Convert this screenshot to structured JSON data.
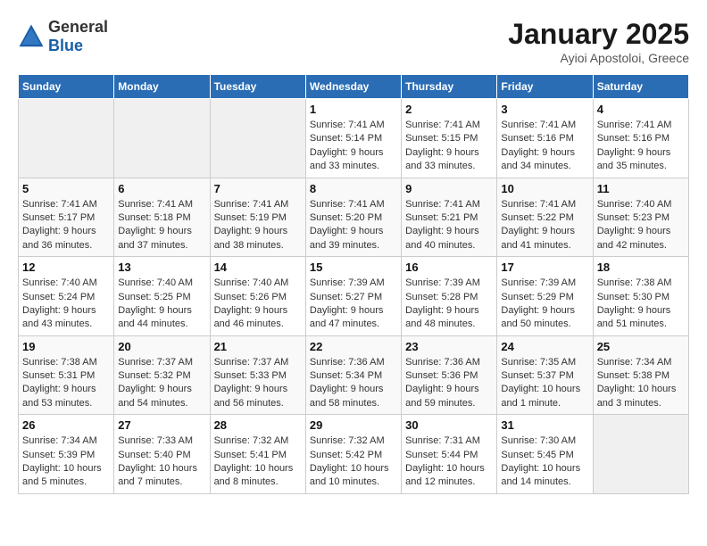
{
  "header": {
    "logo_general": "General",
    "logo_blue": "Blue",
    "month": "January 2025",
    "location": "Ayioi Apostoloi, Greece"
  },
  "weekdays": [
    "Sunday",
    "Monday",
    "Tuesday",
    "Wednesday",
    "Thursday",
    "Friday",
    "Saturday"
  ],
  "weeks": [
    [
      {
        "day": "",
        "info": ""
      },
      {
        "day": "",
        "info": ""
      },
      {
        "day": "",
        "info": ""
      },
      {
        "day": "1",
        "info": "Sunrise: 7:41 AM\nSunset: 5:14 PM\nDaylight: 9 hours and 33 minutes."
      },
      {
        "day": "2",
        "info": "Sunrise: 7:41 AM\nSunset: 5:15 PM\nDaylight: 9 hours and 33 minutes."
      },
      {
        "day": "3",
        "info": "Sunrise: 7:41 AM\nSunset: 5:16 PM\nDaylight: 9 hours and 34 minutes."
      },
      {
        "day": "4",
        "info": "Sunrise: 7:41 AM\nSunset: 5:16 PM\nDaylight: 9 hours and 35 minutes."
      }
    ],
    [
      {
        "day": "5",
        "info": "Sunrise: 7:41 AM\nSunset: 5:17 PM\nDaylight: 9 hours and 36 minutes."
      },
      {
        "day": "6",
        "info": "Sunrise: 7:41 AM\nSunset: 5:18 PM\nDaylight: 9 hours and 37 minutes."
      },
      {
        "day": "7",
        "info": "Sunrise: 7:41 AM\nSunset: 5:19 PM\nDaylight: 9 hours and 38 minutes."
      },
      {
        "day": "8",
        "info": "Sunrise: 7:41 AM\nSunset: 5:20 PM\nDaylight: 9 hours and 39 minutes."
      },
      {
        "day": "9",
        "info": "Sunrise: 7:41 AM\nSunset: 5:21 PM\nDaylight: 9 hours and 40 minutes."
      },
      {
        "day": "10",
        "info": "Sunrise: 7:41 AM\nSunset: 5:22 PM\nDaylight: 9 hours and 41 minutes."
      },
      {
        "day": "11",
        "info": "Sunrise: 7:40 AM\nSunset: 5:23 PM\nDaylight: 9 hours and 42 minutes."
      }
    ],
    [
      {
        "day": "12",
        "info": "Sunrise: 7:40 AM\nSunset: 5:24 PM\nDaylight: 9 hours and 43 minutes."
      },
      {
        "day": "13",
        "info": "Sunrise: 7:40 AM\nSunset: 5:25 PM\nDaylight: 9 hours and 44 minutes."
      },
      {
        "day": "14",
        "info": "Sunrise: 7:40 AM\nSunset: 5:26 PM\nDaylight: 9 hours and 46 minutes."
      },
      {
        "day": "15",
        "info": "Sunrise: 7:39 AM\nSunset: 5:27 PM\nDaylight: 9 hours and 47 minutes."
      },
      {
        "day": "16",
        "info": "Sunrise: 7:39 AM\nSunset: 5:28 PM\nDaylight: 9 hours and 48 minutes."
      },
      {
        "day": "17",
        "info": "Sunrise: 7:39 AM\nSunset: 5:29 PM\nDaylight: 9 hours and 50 minutes."
      },
      {
        "day": "18",
        "info": "Sunrise: 7:38 AM\nSunset: 5:30 PM\nDaylight: 9 hours and 51 minutes."
      }
    ],
    [
      {
        "day": "19",
        "info": "Sunrise: 7:38 AM\nSunset: 5:31 PM\nDaylight: 9 hours and 53 minutes."
      },
      {
        "day": "20",
        "info": "Sunrise: 7:37 AM\nSunset: 5:32 PM\nDaylight: 9 hours and 54 minutes."
      },
      {
        "day": "21",
        "info": "Sunrise: 7:37 AM\nSunset: 5:33 PM\nDaylight: 9 hours and 56 minutes."
      },
      {
        "day": "22",
        "info": "Sunrise: 7:36 AM\nSunset: 5:34 PM\nDaylight: 9 hours and 58 minutes."
      },
      {
        "day": "23",
        "info": "Sunrise: 7:36 AM\nSunset: 5:36 PM\nDaylight: 9 hours and 59 minutes."
      },
      {
        "day": "24",
        "info": "Sunrise: 7:35 AM\nSunset: 5:37 PM\nDaylight: 10 hours and 1 minute."
      },
      {
        "day": "25",
        "info": "Sunrise: 7:34 AM\nSunset: 5:38 PM\nDaylight: 10 hours and 3 minutes."
      }
    ],
    [
      {
        "day": "26",
        "info": "Sunrise: 7:34 AM\nSunset: 5:39 PM\nDaylight: 10 hours and 5 minutes."
      },
      {
        "day": "27",
        "info": "Sunrise: 7:33 AM\nSunset: 5:40 PM\nDaylight: 10 hours and 7 minutes."
      },
      {
        "day": "28",
        "info": "Sunrise: 7:32 AM\nSunset: 5:41 PM\nDaylight: 10 hours and 8 minutes."
      },
      {
        "day": "29",
        "info": "Sunrise: 7:32 AM\nSunset: 5:42 PM\nDaylight: 10 hours and 10 minutes."
      },
      {
        "day": "30",
        "info": "Sunrise: 7:31 AM\nSunset: 5:44 PM\nDaylight: 10 hours and 12 minutes."
      },
      {
        "day": "31",
        "info": "Sunrise: 7:30 AM\nSunset: 5:45 PM\nDaylight: 10 hours and 14 minutes."
      },
      {
        "day": "",
        "info": ""
      }
    ]
  ]
}
